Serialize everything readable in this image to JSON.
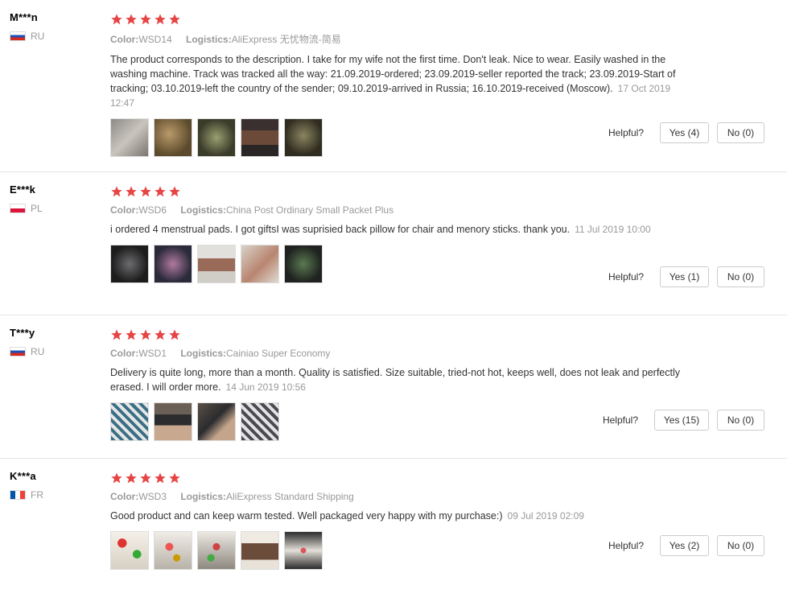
{
  "ui": {
    "color_key": "Color:",
    "logistics_key": "Logistics:",
    "helpful_label": "Helpful?"
  },
  "colors": {
    "star": "#e64545",
    "muted": "#999999",
    "text": "#333333"
  },
  "reviews": [
    {
      "user": "M***n",
      "country_code": "RU",
      "color": "WSD14",
      "logistics": "AliExpress 无忧物流-简易",
      "text": "The product corresponds to the description. I take for my wife not the first time. Don't leak. Nice to wear. Easily washed in the washing machine. Track was tracked all the way: 21.09.2019-ordered; 23.09.2019-seller reported the track; 23.09.2019-Start of tracking; 03.10.2019-left the country of the sender; 09.10.2019-arrived in Russia; 16.10.2019-received (Moscow).",
      "date": "17 Oct 2019 12:47",
      "yes": "Yes (4)",
      "no": "No (0)"
    },
    {
      "user": "E***k",
      "country_code": "PL",
      "color": "WSD6",
      "logistics": "China Post Ordinary Small Packet Plus",
      "text": "i ordered 4 menstrual pads. I got giftsI was suprisied back pillow for chair and menory sticks. thank you.",
      "date": "11 Jul 2019 10:00",
      "yes": "Yes (1)",
      "no": "No (0)"
    },
    {
      "user": "T***y",
      "country_code": "RU",
      "color": "WSD1",
      "logistics": "Cainiao Super Economy",
      "text": "Delivery is quite long, more than a month. Quality is satisfied. Size suitable, tried-not hot, keeps well, does not leak and perfectly erased. I will order more.",
      "date": "14 Jun 2019 10:56",
      "yes": "Yes (15)",
      "no": "No (0)"
    },
    {
      "user": "K***a",
      "country_code": "FR",
      "color": "WSD3",
      "logistics": "AliExpress Standard Shipping",
      "text": "Good product and can keep warm tested. Well packaged very happy with my purchase:)",
      "date": "09 Jul 2019 02:09",
      "yes": "Yes (2)",
      "no": "No (0)"
    }
  ]
}
